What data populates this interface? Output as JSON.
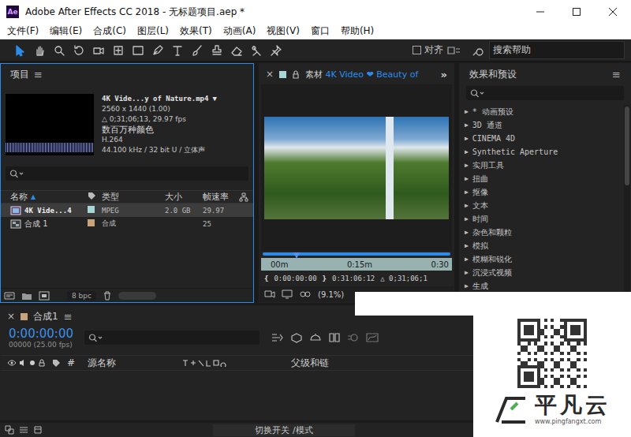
{
  "window": {
    "title": "Adobe After Effects CC 2018 - 无标题项目.aep *",
    "app_icon": "Ae"
  },
  "menu": [
    "文件(F)",
    "编辑(E)",
    "合成(C)",
    "图层(L)",
    "效果(T)",
    "动画(A)",
    "视图(V)",
    "窗口",
    "帮助(H)"
  ],
  "toolbar": {
    "tools": [
      {
        "selected": true
      },
      {
        "selected": false
      },
      {
        "selected": false
      },
      {
        "selected": false
      },
      {
        "selected": false
      },
      {
        "selected": false
      },
      {
        "selected": false
      },
      {
        "selected": false
      },
      {
        "selected": false
      },
      {
        "selected": false
      },
      {
        "selected": false
      },
      {
        "selected": false
      },
      {
        "selected": false
      },
      {
        "selected": false
      }
    ],
    "snap": {
      "label": "对齐",
      "checked": false
    },
    "search": {
      "placeholder": "搜索帮助"
    }
  },
  "project": {
    "title": "项目",
    "menu": "≡",
    "focused": true,
    "preview": {
      "name": "4K Vide...y of Nature.mp4",
      "dropdown": "▼",
      "lines": [
        "2560 x 1440 (1.00)",
        "△ 0;31;06;13, 29.97 fps",
        "数百万种颜色",
        "H.264",
        "44.100 kHz / 32 bit U / 立体声"
      ]
    },
    "columns": [
      "名称",
      "类型",
      "大小",
      "帧速率"
    ],
    "sort_glyph": "▲",
    "rows": [
      {
        "kind": "footage",
        "name": "4K Vide...4",
        "type": "MPEG",
        "size": "2.0 GB",
        "fps": "29.97",
        "color": "#a6d6d6",
        "selected": true
      },
      {
        "kind": "composition",
        "name": "合成 1",
        "type": "合成",
        "size": "",
        "fps": "25",
        "color": "#c8a47a",
        "selected": false
      }
    ],
    "bpc": "8 bpc"
  },
  "viewer": {
    "close": "×",
    "label": "素材",
    "title": "4K Video ❤ Beauty of",
    "overflow": "»",
    "ruler": [
      "00m",
      "0:15m",
      "0:30"
    ],
    "playhead": 0.19,
    "in_mark": "{",
    "time_in": "0:00:00:00",
    "out_mark": "}",
    "time_out": "0:31:06:12",
    "duration": "△ 0;31;06;1",
    "zoom": "(9.1%)"
  },
  "effects": {
    "title": "效果和预设",
    "menu": "≡",
    "glyph": "▶",
    "items": [
      "* 动画预设",
      "3D 通道",
      "CINEMA 4D",
      "Synthetic Aperture",
      "实用工具",
      "扭曲",
      "抠像",
      "文本",
      "时间",
      "杂色和颗粒",
      "模拟",
      "模糊和锐化",
      "沉浸式视频",
      "生成"
    ]
  },
  "timeline": {
    "close": "×",
    "title": "合成1",
    "menu": "≡",
    "time": "0:00:00:00",
    "frame_info": "00000 (25.00 fps)",
    "columns": [
      "#",
      "源名称",
      "父级和链"
    ]
  },
  "status": {
    "toggle": "切换开关 /模式"
  },
  "watermark": {
    "brand": "平凡云",
    "url": "www.pingfangxt.com"
  }
}
